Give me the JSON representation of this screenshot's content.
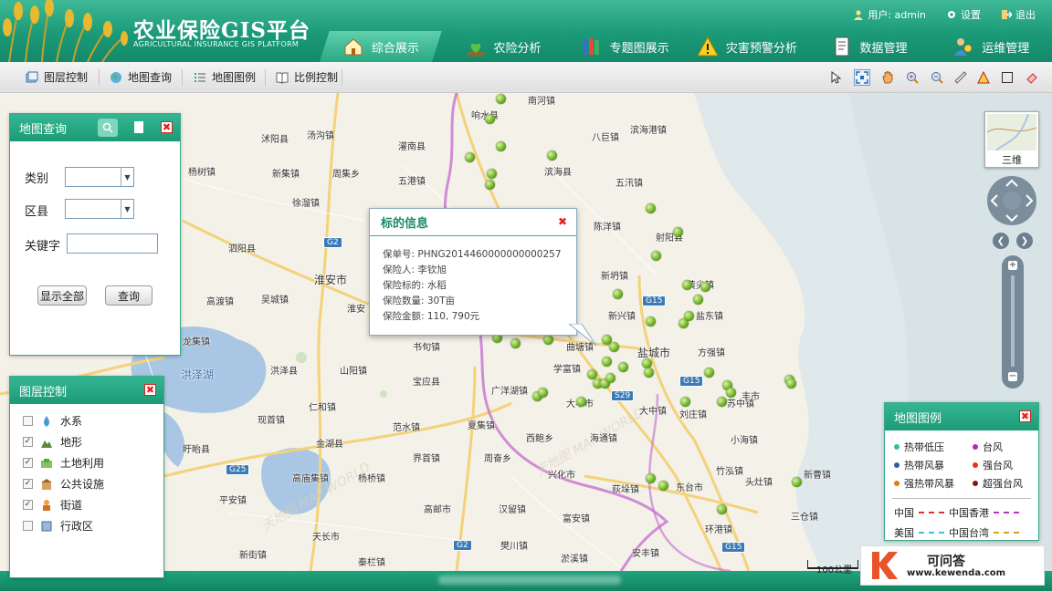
{
  "header": {
    "logo_cn": "农业保险GIS平台",
    "logo_en": "AGRICULTURAL INSURANCE GIS PLATFORM",
    "user_label": "用户: admin",
    "settings_label": "设置",
    "logout_label": "退出",
    "nav": [
      {
        "label": "综合展示",
        "icon": "home-icon",
        "active": true
      },
      {
        "label": "农险分析",
        "icon": "plant-icon"
      },
      {
        "label": "专题图展示",
        "icon": "books-icon"
      },
      {
        "label": "灾害预警分析",
        "icon": "warning-icon"
      },
      {
        "label": "数据管理",
        "icon": "document-icon"
      },
      {
        "label": "运维管理",
        "icon": "person-icon"
      }
    ]
  },
  "toolbar": {
    "layer_control": "图层控制",
    "map_query": "地图查询",
    "map_legend": "地图图例",
    "scale_control": "比例控制",
    "tools": [
      "pointer-icon",
      "full-extent-icon",
      "pan-hand-icon",
      "zoom-in-icon",
      "zoom-out-icon",
      "measure-ruler-icon",
      "area-measure-icon",
      "rectangle-select-icon",
      "eraser-icon"
    ]
  },
  "query_panel": {
    "title": "地图查询",
    "category_label": "类别",
    "district_label": "区县",
    "keyword_label": "关键字",
    "category_value": "",
    "district_value": "",
    "keyword_value": "",
    "show_all_button": "显示全部",
    "query_button": "查询"
  },
  "layer_panel": {
    "title": "图层控制",
    "layers": [
      {
        "label": "水系",
        "checked": false,
        "icon": "water-drop-icon"
      },
      {
        "label": "地形",
        "checked": true,
        "icon": "terrain-icon"
      },
      {
        "label": "土地利用",
        "checked": true,
        "icon": "land-use-icon"
      },
      {
        "label": "公共设施",
        "checked": true,
        "icon": "facility-icon"
      },
      {
        "label": "街道",
        "checked": true,
        "icon": "street-icon"
      },
      {
        "label": "行政区",
        "checked": false,
        "icon": "admin-region-icon"
      }
    ]
  },
  "popup": {
    "title": "标的信息",
    "policy_no": "保单号: PHNG2014460000000000257",
    "insured": "保险人: 李钦旭",
    "subject": "保险标的: 水稻",
    "quantity": "保险数量: 30T亩",
    "amount": "保险金额: 110, 790元"
  },
  "legend": {
    "title": "地图图例",
    "items": [
      {
        "label": "热带低压",
        "color": "#2fc0a0"
      },
      {
        "label": "台风",
        "color": "#c01fc0"
      },
      {
        "label": "热带风暴",
        "color": "#2c5fa8"
      },
      {
        "label": "强台风",
        "color": "#e0321e"
      },
      {
        "label": "强热带风暴",
        "color": "#e07a1a"
      },
      {
        "label": "超强台风",
        "color": "#8a1010"
      }
    ],
    "lines": [
      {
        "label": "中国",
        "color": "#e03030"
      },
      {
        "label": "中国香港",
        "color": "#c030c0"
      },
      {
        "label": "美国",
        "color": "#30c8d8"
      },
      {
        "label": "中国台湾",
        "color": "#e0a020"
      }
    ]
  },
  "map": {
    "three_d_label": "三维",
    "scale_label": "100公里",
    "places": [
      {
        "name": "南河镇"
      },
      {
        "name": "响水县"
      },
      {
        "name": "沭阳县"
      },
      {
        "name": "汤沟镇"
      },
      {
        "name": "灌南县"
      },
      {
        "name": "八巨镇"
      },
      {
        "name": "滨海港镇"
      },
      {
        "name": "杨树镇"
      },
      {
        "name": "新集镇"
      },
      {
        "name": "周集乡"
      },
      {
        "name": "五港镇"
      },
      {
        "name": "滨海县"
      },
      {
        "name": "五汛镇"
      },
      {
        "name": "徐溜镇"
      },
      {
        "name": "泗阳县"
      },
      {
        "name": "陈洋镇"
      },
      {
        "name": "射阳县"
      },
      {
        "name": "淮安市"
      },
      {
        "name": "高渡镇"
      },
      {
        "name": "吴城镇"
      },
      {
        "name": "新坍镇"
      },
      {
        "name": "黄尖镇"
      },
      {
        "name": "盐东镇"
      },
      {
        "name": "盐城市"
      },
      {
        "name": "新兴镇"
      },
      {
        "name": "方强镇"
      },
      {
        "name": "龙集镇"
      },
      {
        "name": "洪泽湖"
      },
      {
        "name": "洪泽县"
      },
      {
        "name": "山阳镇"
      },
      {
        "name": "书旬镇"
      },
      {
        "name": "学富镇"
      },
      {
        "name": "大丰市"
      },
      {
        "name": "仁和镇"
      },
      {
        "name": "宝应县"
      },
      {
        "name": "广洋湖镇"
      },
      {
        "name": "大中镇"
      },
      {
        "name": "盱眙县"
      },
      {
        "name": "现首镇"
      },
      {
        "name": "金湖县"
      },
      {
        "name": "范水镇"
      },
      {
        "name": "夏集镇"
      },
      {
        "name": "海通镇"
      },
      {
        "name": "西鲍乡"
      },
      {
        "name": "刘庄镇"
      },
      {
        "name": "小海镇"
      },
      {
        "name": "竹泓镇"
      },
      {
        "name": "界首镇"
      },
      {
        "name": "周奋乡"
      },
      {
        "name": "新曹镇"
      },
      {
        "name": "苏中镇"
      },
      {
        "name": "高庙集镇"
      },
      {
        "name": "兴化市"
      },
      {
        "name": "杨桥镇"
      },
      {
        "name": "东台市"
      },
      {
        "name": "头灶镇"
      },
      {
        "name": "平安镇"
      },
      {
        "name": "高邮市"
      },
      {
        "name": "三仓镇"
      },
      {
        "name": "汉留镇"
      },
      {
        "name": "天长市"
      },
      {
        "name": "富安镇"
      },
      {
        "name": "荻垛镇"
      },
      {
        "name": "新街镇"
      },
      {
        "name": "秦栏镇"
      },
      {
        "name": "樊川镇"
      },
      {
        "name": "淤溪镇"
      },
      {
        "name": "安丰镇"
      },
      {
        "name": "曲塘镇"
      },
      {
        "name": "环港镇"
      },
      {
        "name": "丰市"
      },
      {
        "name": "淮安"
      }
    ],
    "highways": [
      "G2",
      "G15",
      "G15",
      "S29",
      "G25",
      "G2",
      "G15"
    ]
  },
  "watermark": {
    "brand": "可问答",
    "url": "www.kewenda.com"
  }
}
